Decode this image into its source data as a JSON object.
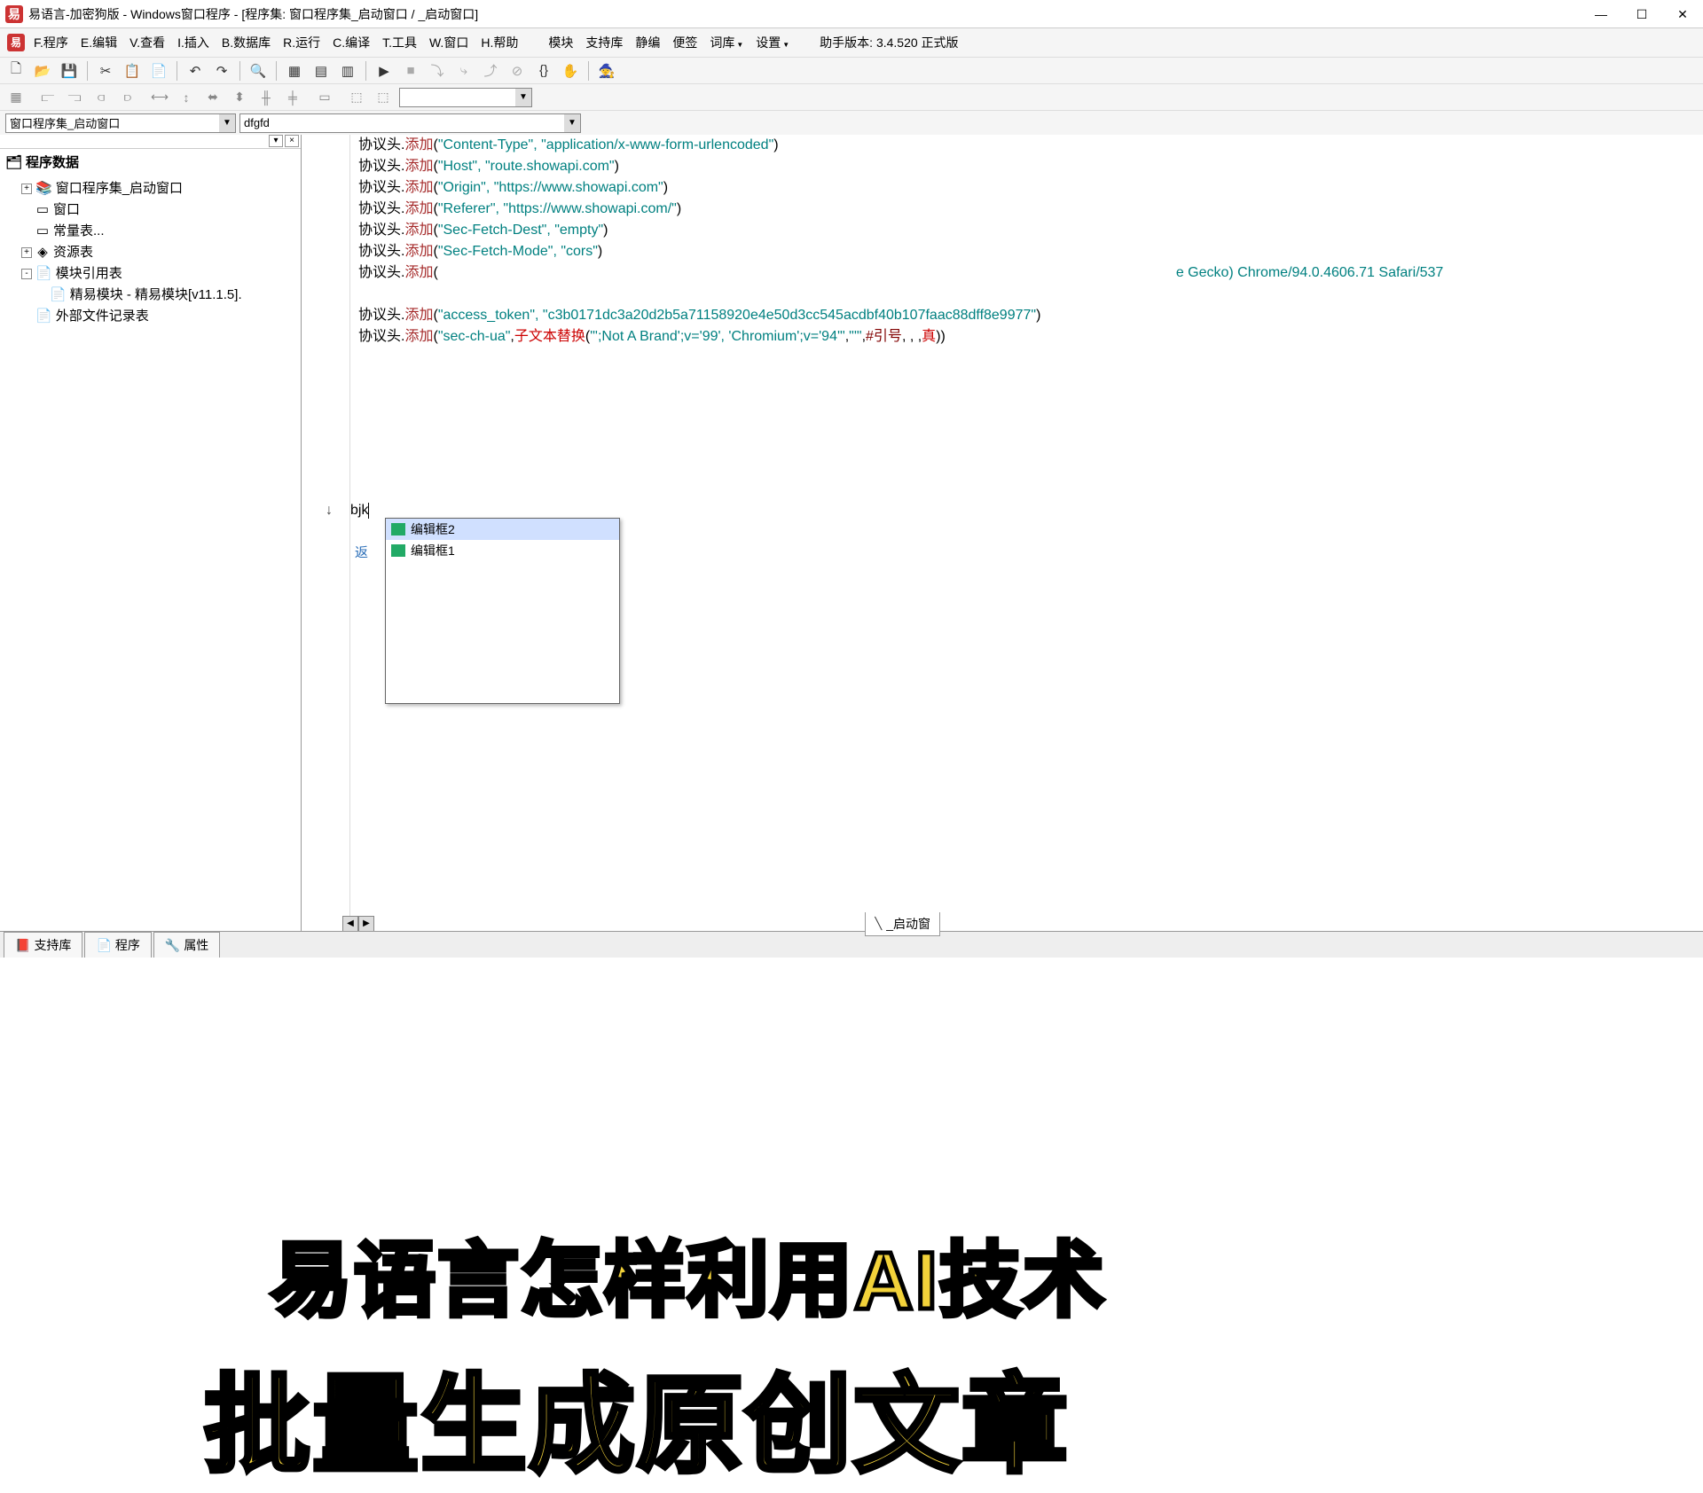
{
  "window": {
    "title": "易语言-加密狗版 - Windows窗口程序 - [程序集: 窗口程序集_启动窗口 / _启动窗口]"
  },
  "menu": {
    "items": [
      "F.程序",
      "E.编辑",
      "V.查看",
      "I.插入",
      "B.数据库",
      "R.运行",
      "C.编译",
      "T.工具",
      "W.窗口",
      "H.帮助"
    ],
    "groups": [
      "模块",
      "支持库",
      "静编",
      "便签"
    ],
    "dropdowns": [
      "词库",
      "设置"
    ],
    "version": "助手版本: 3.4.520 正式版"
  },
  "left_combo": "窗口程序集_启动窗口",
  "right_combo": "dfgfd",
  "tree": {
    "header": "程序数据",
    "nodes": [
      {
        "pm": "+",
        "icon": "📚",
        "label": "窗口程序集_启动窗口"
      },
      {
        "pm": "",
        "icon": "▭",
        "label": "窗口"
      },
      {
        "pm": "",
        "icon": "▭",
        "label": "常量表..."
      },
      {
        "pm": "+",
        "icon": "◈",
        "label": "资源表"
      },
      {
        "pm": "-",
        "icon": "📄",
        "label": "模块引用表"
      },
      {
        "pm": "",
        "icon": "📄",
        "label": "精易模块 - 精易模块[v11.1.5].",
        "indent": 1
      },
      {
        "pm": "",
        "icon": "📄",
        "label": "外部文件记录表"
      }
    ]
  },
  "code": {
    "lines": [
      {
        "obj": "协议头",
        "m": "添加",
        "args": "(\"Content-Type\", \"application/x-www-form-urlencoded\")"
      },
      {
        "obj": "协议头",
        "m": "添加",
        "args": "(\"Host\", \"route.showapi.com\")"
      },
      {
        "obj": "协议头",
        "m": "添加",
        "args": "(\"Origin\", \"https://www.showapi.com\")"
      },
      {
        "obj": "协议头",
        "m": "添加",
        "args": "(\"Referer\", \"https://www.showapi.com/\")"
      },
      {
        "obj": "协议头",
        "m": "添加",
        "args": "(\"Sec-Fetch-Dest\", \"empty\")"
      },
      {
        "obj": "协议头",
        "m": "添加",
        "args": "(\"Sec-Fetch-Mode\", \"cors\")"
      },
      {
        "obj": "协议头",
        "m": "添加",
        "argsuffix": "e Gecko) Chrome/94.0.4606.71 Safari/537"
      },
      {
        "obj": "协议头",
        "m": "添加",
        "args": "(\"access_token\", \"c3b0171dc3a20d2b5a71158920e4e50d3cc545acdbf40b107faac88dff8e9977\")"
      },
      {
        "obj": "协议头",
        "m": "添加",
        "argmix": true
      }
    ],
    "argmix": {
      "pre": "(\"sec-ch-ua\", ",
      "fn": "子文本替换",
      "mid": " (\"\";Not A Brand';v='99', 'Chromium';v='94'\", \"'\", ",
      "ref": "#引号",
      "post": ", , , 真))"
    },
    "input": "bjk",
    "return_label": "返",
    "autocomplete": [
      "编辑框2",
      "编辑框1"
    ]
  },
  "bottom_tabs": [
    "支持库",
    "程序",
    "属性"
  ],
  "editor_tab": "_启动窗",
  "overlay": {
    "line1": "易语言怎样利用AI技术",
    "line2": "批量生成原创文章"
  }
}
